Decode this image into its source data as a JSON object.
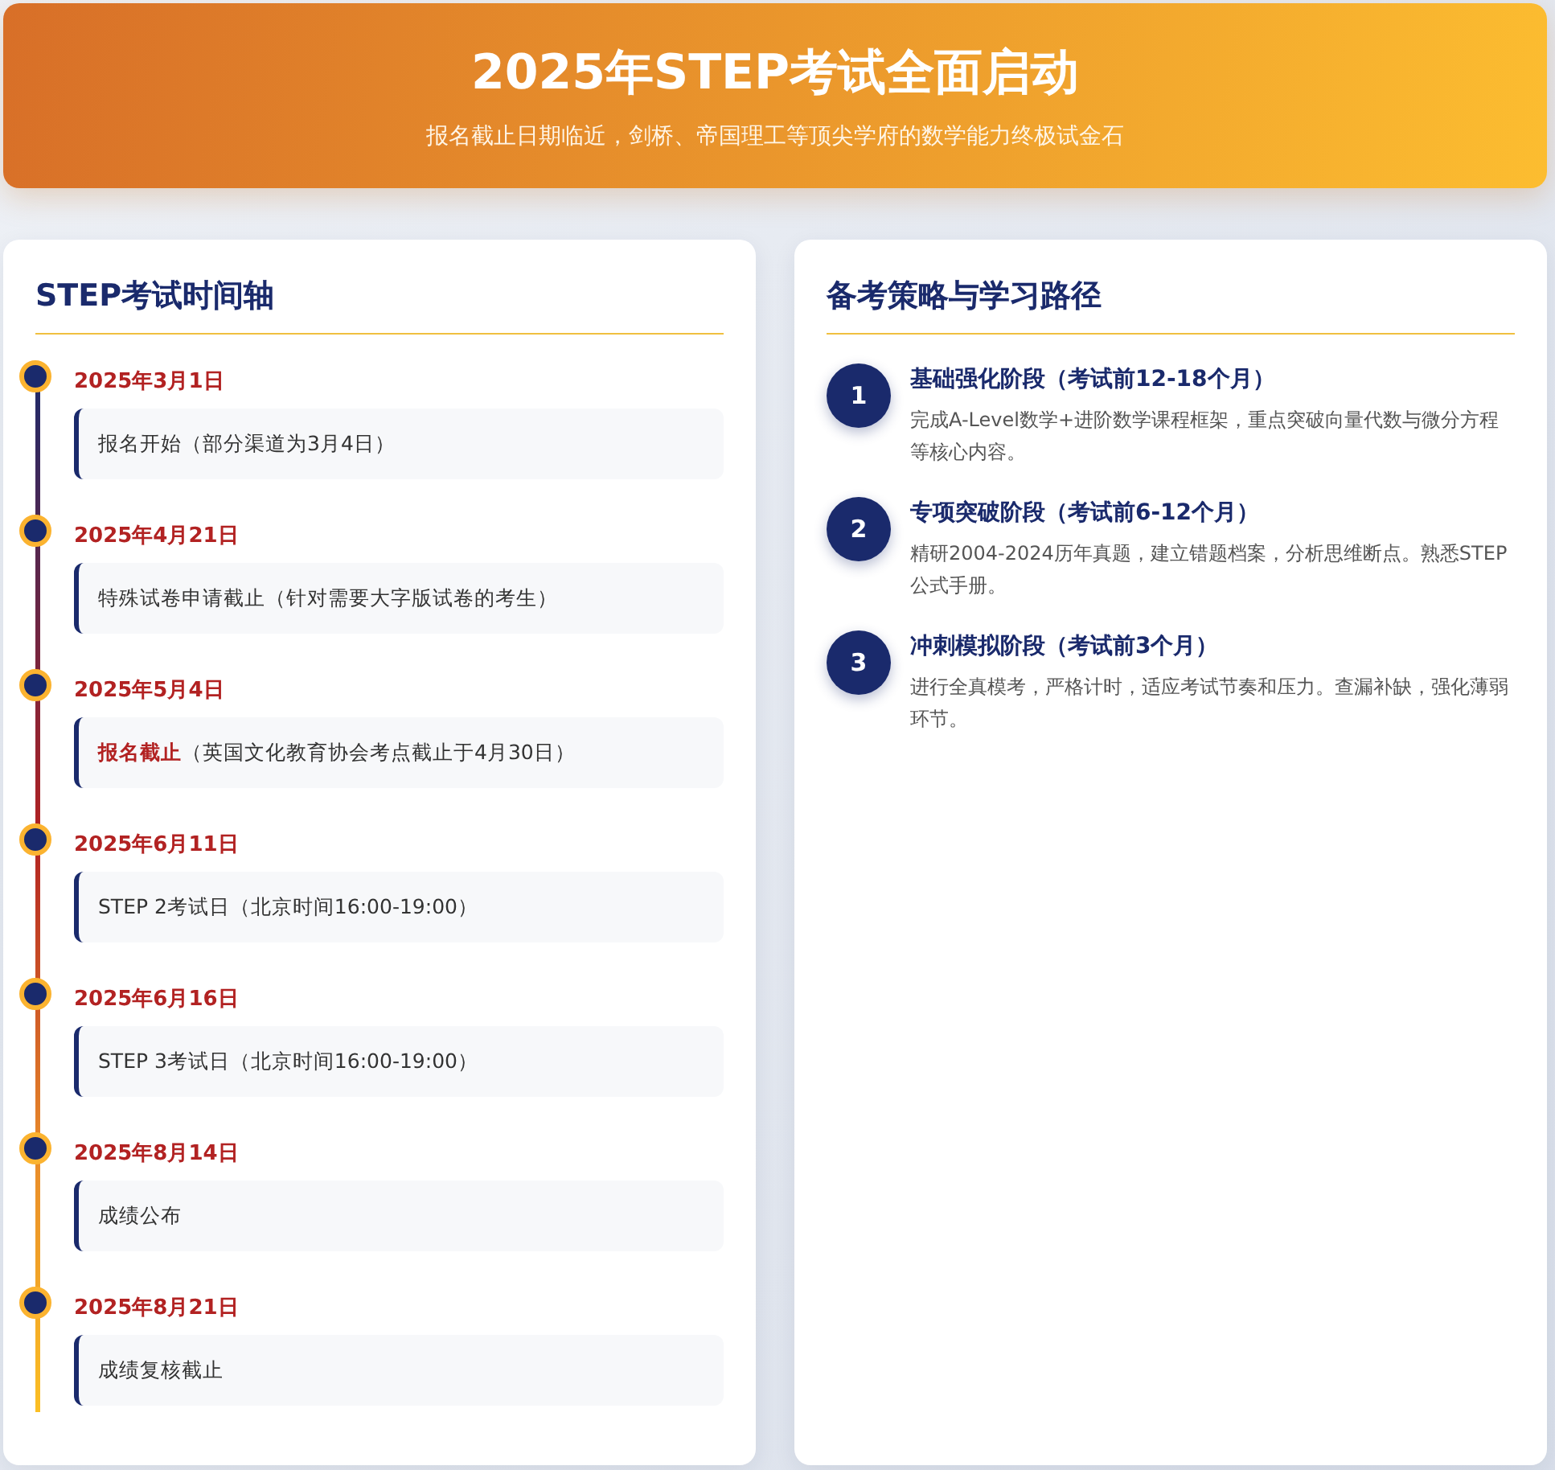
{
  "header": {
    "title": "2025年STEP考试全面启动",
    "subtitle": "报名截止日期临近，剑桥、帝国理工等顶尖学府的数学能力终极试金石"
  },
  "timeline": {
    "title": "STEP考试时间轴",
    "events": [
      {
        "date": "2025年3月1日",
        "description": "报名开始（部分渠道为3月4日）"
      },
      {
        "date": "2025年4月21日",
        "description": "特殊试卷申请截止（针对需要大字版试卷的考生）"
      },
      {
        "date": "2025年5月4日",
        "description": "**报名截止**（英国文化教育协会考点截止于4月30日）"
      },
      {
        "date": "2025年6月11日",
        "description": "STEP 2考试日（北京时间16:00-19:00）"
      },
      {
        "date": "2025年6月16日",
        "description": "STEP 3考试日（北京时间16:00-19:00）"
      },
      {
        "date": "2025年8月14日",
        "description": "成绩公布"
      },
      {
        "date": "2025年8月21日",
        "description": "成绩复核截止"
      }
    ]
  },
  "strategy": {
    "title": "备考策略与学习路径",
    "steps": [
      {
        "number": "1",
        "title": "基础强化阶段（考试前12-18个月）",
        "description": "完成A-Level数学+进阶数学课程框架，重点突破向量代数与微分方程等核心内容。"
      },
      {
        "number": "2",
        "title": "专项突破阶段（考试前6-12个月）",
        "description": "精研2004-2024历年真题，建立错题档案，分析思维断点。熟悉STEP公式手册。"
      },
      {
        "number": "3",
        "title": "冲刺模拟阶段（考试前3个月）",
        "description": "进行全真模考，严格计时，适应考试节奏和压力。查漏补缺，强化薄弱环节。"
      }
    ]
  }
}
